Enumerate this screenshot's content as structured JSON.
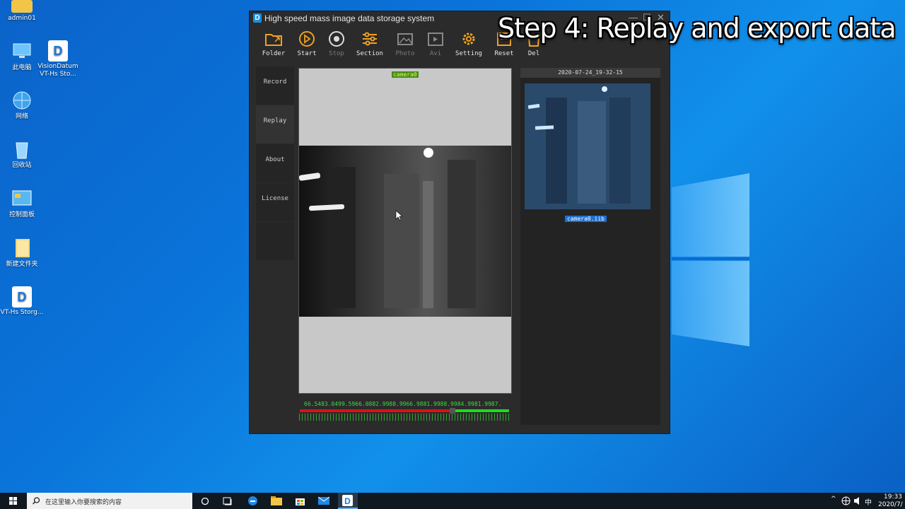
{
  "overlay": {
    "caption": "Step 4: Replay and export data"
  },
  "desktop": {
    "icons": [
      {
        "label": "admin01"
      },
      {
        "label": "此电脑"
      },
      {
        "label": "VisionDatum VT-Hs Sto..."
      },
      {
        "label": "网络"
      },
      {
        "label": "回收站"
      },
      {
        "label": "控制面板"
      },
      {
        "label": "新建文件夹"
      },
      {
        "label": "VT-Hs Storg..."
      }
    ]
  },
  "app": {
    "title": "High speed mass image data storage system",
    "icon_letter": "D",
    "window_buttons": {
      "minimize": "—",
      "maximize": "☐",
      "close": "✕"
    },
    "toolbar": {
      "folder": "Folder",
      "start": "Start",
      "stop": "Stop",
      "section": "Section",
      "photo": "Photo",
      "avi": "Avi",
      "setting": "Setting",
      "reset": "Reset",
      "del": "Del"
    },
    "sidebar": {
      "record": "Record",
      "replay": "Replay",
      "about": "About",
      "license": "License"
    },
    "viewer": {
      "camera_label": "camera0"
    },
    "timeline": {
      "values_text": "66.5483.0499.5966.0882.9988.9966.9881.9988.9984.9981.9987."
    },
    "right_panel": {
      "date": "2020-07-24_19-32-15",
      "file": "camera0.iib"
    },
    "colors": {
      "accent_icons": "#f0a020",
      "timeline_red": "#e01010",
      "timeline_green": "#18e018",
      "file_tag": "#1e6fd0"
    }
  },
  "taskbar": {
    "search_placeholder": "在这里输入你要搜索的内容",
    "tray": {
      "time": "19:33",
      "date": "2020/7/",
      "ime": "中"
    }
  }
}
